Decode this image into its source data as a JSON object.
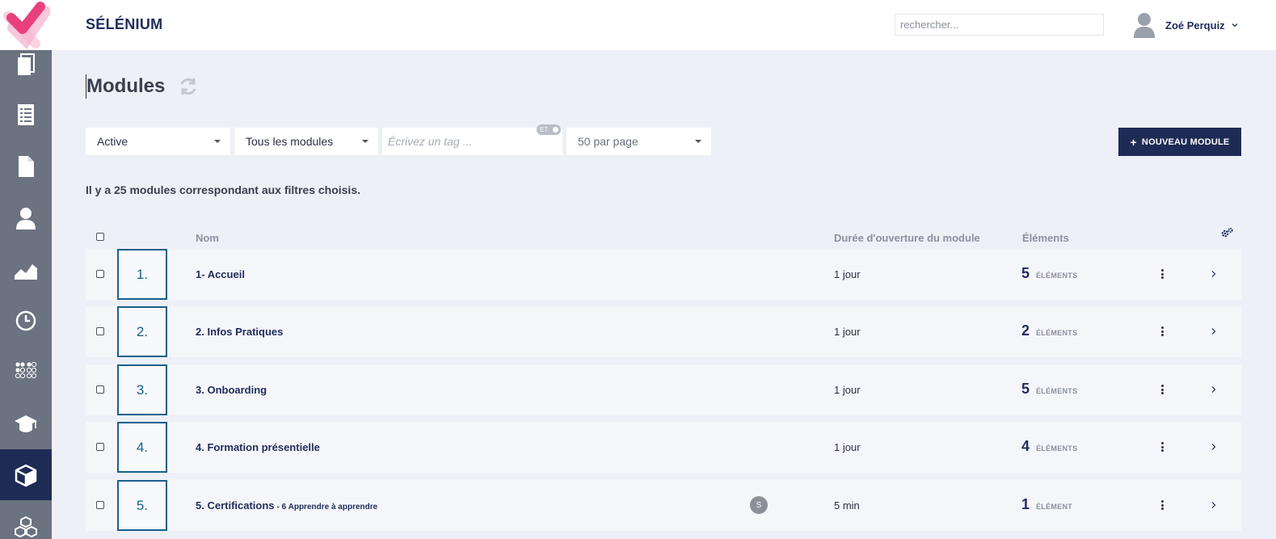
{
  "header": {
    "app_title": "SÉLÉNIUM",
    "search_placeholder": "rechercher...",
    "user_name": "Zoé Perquiz"
  },
  "page": {
    "title": "Modules"
  },
  "filters": {
    "status": "Active",
    "scope": "Tous les modules",
    "tag_placeholder": "Écrivez un tag ...",
    "tag_badge": "ET",
    "per_page": "50 par page"
  },
  "new_button": {
    "plus": "+",
    "label": "NOUVEAU MODULE"
  },
  "count_text": "Il y a 25 modules correspondant aux filtres choisis.",
  "table": {
    "columns": {
      "name": "Nom",
      "duration": "Durée d'ouverture du module",
      "elements": "Éléments"
    },
    "rows": [
      {
        "num": "1.",
        "name": "1- Accueil",
        "sub": "",
        "badge": "",
        "duration": "1 jour",
        "count": "5",
        "unit": "ÉLÉMENTS"
      },
      {
        "num": "2.",
        "name": "2. Infos Pratiques",
        "sub": "",
        "badge": "",
        "duration": "1 jour",
        "count": "2",
        "unit": "ÉLÉMENTS"
      },
      {
        "num": "3.",
        "name": "3. Onboarding",
        "sub": "",
        "badge": "",
        "duration": "1 jour",
        "count": "5",
        "unit": "ÉLÉMENTS"
      },
      {
        "num": "4.",
        "name": "4. Formation présentielle",
        "sub": "",
        "badge": "",
        "duration": "1 jour",
        "count": "4",
        "unit": "ÉLÉMENTS"
      },
      {
        "num": "5.",
        "name": "5. Certifications",
        "sub": "- 6 Apprendre à apprendre",
        "badge": "S",
        "duration": "5 min",
        "count": "1",
        "unit": "ÉLÉMENT"
      }
    ]
  },
  "colors": {
    "brand_navy": "#1e2b55",
    "sidebar_gray": "#6b7280",
    "number_blue": "#1a5f8c",
    "logo_pink": "#e8407a"
  },
  "sidebar": {
    "items": [
      {
        "icon": "copy-icon"
      },
      {
        "icon": "list-icon"
      },
      {
        "icon": "document-icon"
      },
      {
        "icon": "user-icon"
      },
      {
        "icon": "area-chart-icon"
      },
      {
        "icon": "clock-icon"
      },
      {
        "icon": "dots-grid-icon"
      },
      {
        "icon": "graduation-cap-icon"
      },
      {
        "icon": "cube-icon",
        "active": true
      },
      {
        "icon": "cubes-icon"
      }
    ]
  }
}
